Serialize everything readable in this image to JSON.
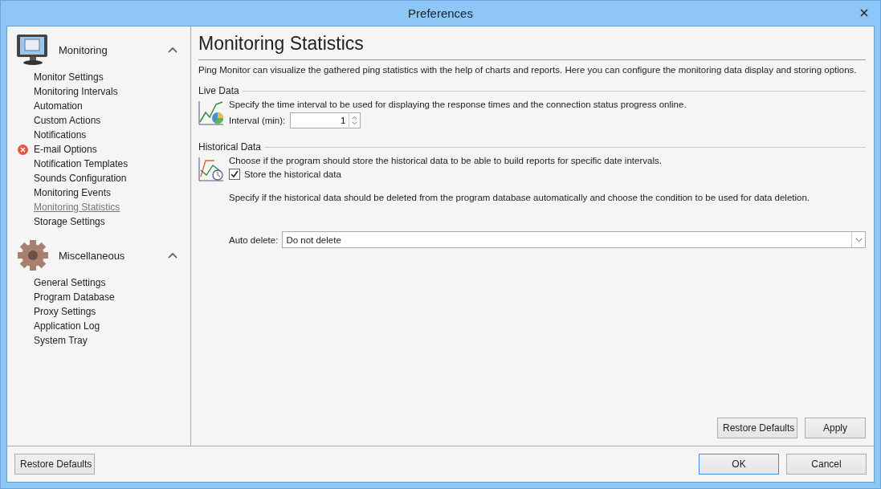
{
  "window": {
    "title": "Preferences"
  },
  "sidebar": {
    "groups": [
      {
        "label": "Monitoring",
        "kind": "monitor",
        "expanded": true,
        "items": [
          {
            "label": "Monitor Settings",
            "selected": false,
            "error": false
          },
          {
            "label": "Monitoring Intervals",
            "selected": false,
            "error": false
          },
          {
            "label": "Automation",
            "selected": false,
            "error": false
          },
          {
            "label": "Custom Actions",
            "selected": false,
            "error": false
          },
          {
            "label": "Notifications",
            "selected": false,
            "error": false
          },
          {
            "label": "E-mail Options",
            "selected": false,
            "error": true
          },
          {
            "label": "Notification Templates",
            "selected": false,
            "error": false
          },
          {
            "label": "Sounds Configuration",
            "selected": false,
            "error": false
          },
          {
            "label": "Monitoring Events",
            "selected": false,
            "error": false
          },
          {
            "label": "Monitoring Statistics",
            "selected": true,
            "error": false
          },
          {
            "label": "Storage Settings",
            "selected": false,
            "error": false
          }
        ]
      },
      {
        "label": "Miscellaneous",
        "kind": "gear",
        "expanded": true,
        "items": [
          {
            "label": "General Settings",
            "selected": false,
            "error": false
          },
          {
            "label": "Program Database",
            "selected": false,
            "error": false
          },
          {
            "label": "Proxy Settings",
            "selected": false,
            "error": false
          },
          {
            "label": "Application Log",
            "selected": false,
            "error": false
          },
          {
            "label": "System Tray",
            "selected": false,
            "error": false
          }
        ]
      }
    ],
    "restore_button": "Restore Defaults"
  },
  "main": {
    "title": "Monitoring Statistics",
    "description": "Ping Monitor can visualize the gathered ping statistics with the help of charts and reports. Here you can configure the monitoring data display and storing options.",
    "live_data": {
      "heading": "Live Data",
      "text": "Specify the time interval to be used for displaying the response times and the connection status progress online.",
      "interval_label": "Interval (min):",
      "interval_value": "1"
    },
    "historical_data": {
      "heading": "Historical Data",
      "text": "Choose if the program should store the historical data to be able to build reports for specific date intervals.",
      "store_label": "Store the historical data",
      "store_checked": true,
      "delete_text": "Specify if the historical data should be deleted from the program database automatically and choose the condition to be used for data deletion.",
      "auto_delete_label": "Auto delete:",
      "auto_delete_value": "Do not delete"
    },
    "buttons": [
      "Restore Defaults",
      "Apply"
    ]
  },
  "footer_buttons": [
    {
      "label": "OK",
      "default": true
    },
    {
      "label": "Cancel",
      "default": false
    }
  ]
}
